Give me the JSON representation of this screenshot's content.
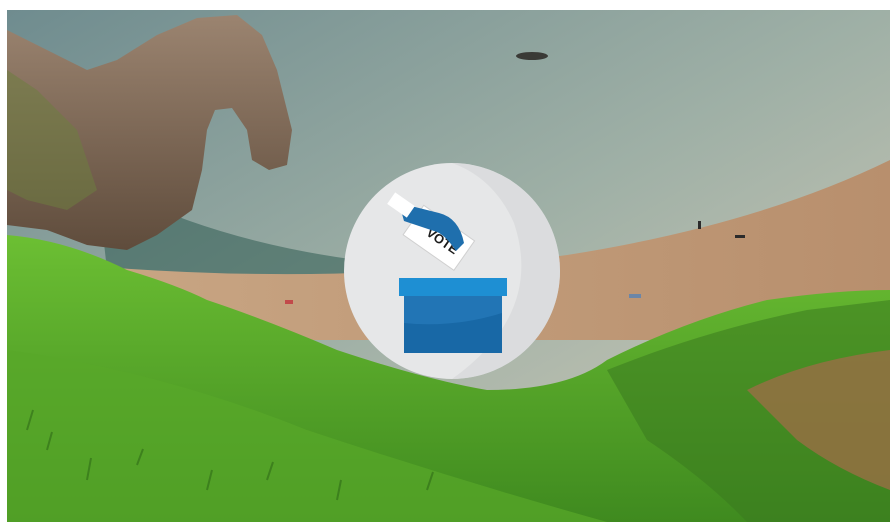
{
  "scene": {
    "description_icon": "landscape-photo",
    "colors": {
      "sea": "#8fa6a1",
      "sky_haze": "#c9c8b8",
      "cliff": "#8a7260",
      "beach": "#c2a07f",
      "grass": "#5fae2b",
      "grass_dark": "#2f6e1c"
    }
  },
  "vote_badge": {
    "icon": "ballot-box-icon",
    "ballot_text": "VOTE",
    "colors": {
      "circle": "#e6e7e8",
      "hand": "#1f6fad",
      "box_top": "#1e8fd3",
      "box_body": "#1868a6",
      "ballot": "#ffffff"
    }
  }
}
